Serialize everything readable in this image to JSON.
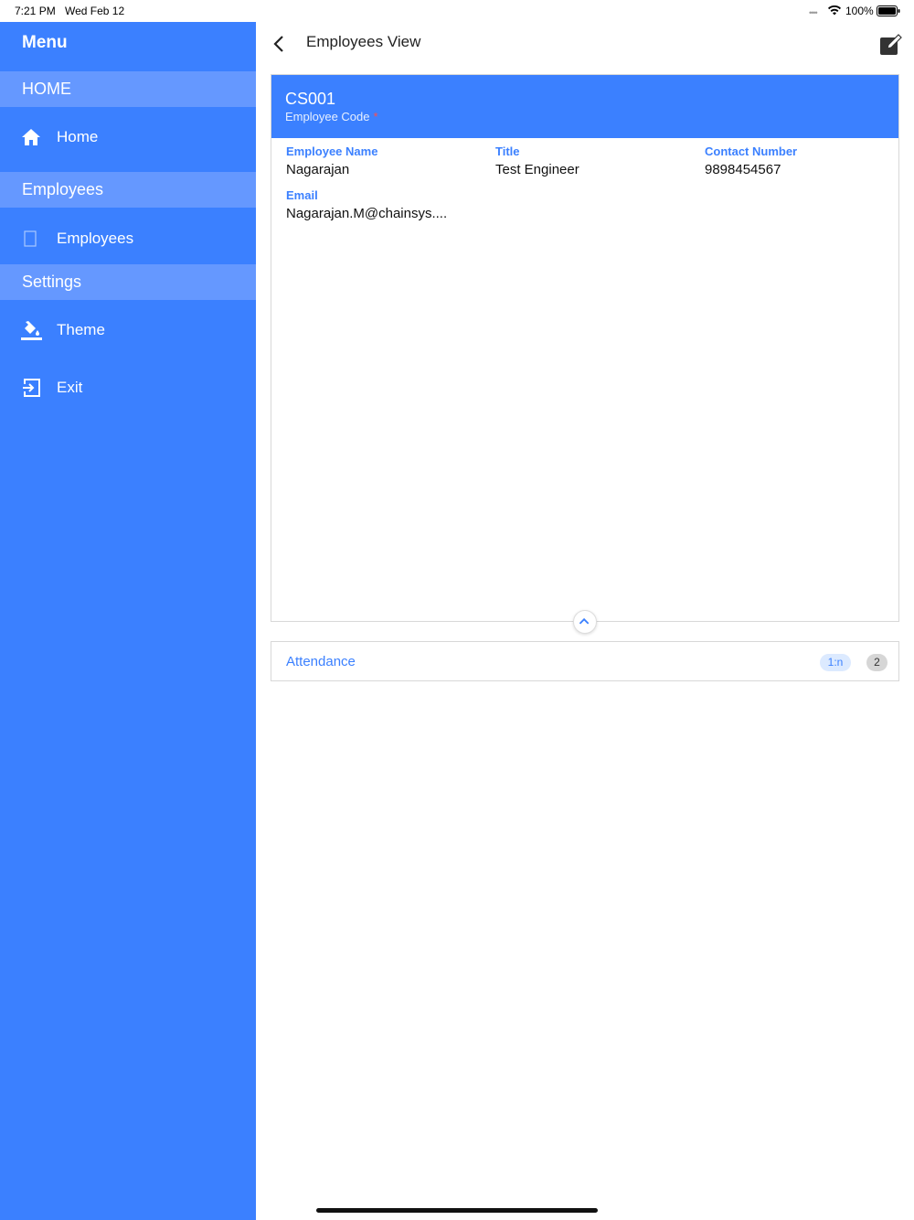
{
  "status_bar": {
    "time": "7:21 PM",
    "date": "Wed Feb 12",
    "battery": "100%"
  },
  "sidebar": {
    "title": "Menu",
    "sections": [
      {
        "header": "HOME",
        "items": [
          {
            "label": "Home",
            "icon": "home-icon"
          }
        ]
      },
      {
        "header": "Employees",
        "items": [
          {
            "label": "Employees",
            "icon": "checkbox-icon"
          }
        ]
      },
      {
        "header": "Settings",
        "items": [
          {
            "label": "Theme",
            "icon": "paint-bucket-icon"
          },
          {
            "label": "Exit",
            "icon": "exit-icon"
          }
        ]
      }
    ]
  },
  "header": {
    "title": "Employees View"
  },
  "record": {
    "code_value": "CS001",
    "code_label": "Employee Code",
    "required_marker": "*",
    "fields": [
      {
        "label": "Employee Name",
        "value": "Nagarajan"
      },
      {
        "label": "Title",
        "value": "Test Engineer"
      },
      {
        "label": "Contact Number",
        "value": "9898454567"
      },
      {
        "label": "Email",
        "value": "Nagarajan.M@chainsys...."
      }
    ]
  },
  "related": {
    "label": "Attendance",
    "relation": "1:n",
    "count": "2"
  },
  "colors": {
    "primary": "#3b80ff",
    "section_header": "#6598ff"
  }
}
